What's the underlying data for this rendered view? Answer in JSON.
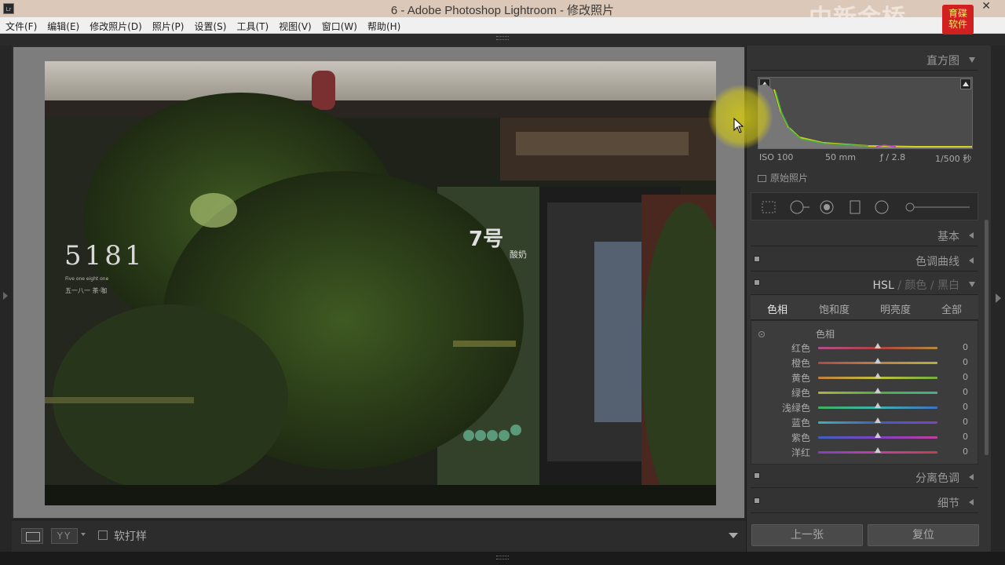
{
  "window": {
    "app_icon": "Lr",
    "title": "6 - Adobe Photoshop Lightroom - 修改照片",
    "watermark": "中新金桥",
    "badge_line1": "育碟",
    "badge_line2": "软件",
    "close": "✕"
  },
  "menu": {
    "file": "文件(F)",
    "edit": "编辑(E)",
    "develop": "修改照片(D)",
    "photo": "照片(P)",
    "settings": "设置(S)",
    "tools": "工具(T)",
    "view": "视图(V)",
    "window": "窗口(W)",
    "help": "帮助(H)"
  },
  "photo": {
    "sign_number": "5181",
    "sign_sub": "Five one eight one",
    "sign_sub2": "五一八一 茶·咖",
    "door_logo": "7号",
    "door_text": "酸奶"
  },
  "toolbar": {
    "yy": "YY",
    "soft_proof_label": "软打样"
  },
  "panel": {
    "histogram": {
      "title": "直方图",
      "iso": "ISO 100",
      "focal": "50 mm",
      "aperture": "ƒ / 2.8",
      "shutter": "1/500 秒",
      "original_photo": "原始照片"
    },
    "basic": "基本",
    "tone_curve": "色调曲线",
    "hsl_header": {
      "hsl": "HSL",
      "sep1": "/",
      "color": "颜色",
      "sep2": "/",
      "bw": "黑白"
    },
    "hsl_tabs": {
      "hue": "色相",
      "saturation": "饱和度",
      "luminance": "明亮度",
      "all": "全部"
    },
    "hsl_section_title": "色相",
    "hsl_rows": [
      {
        "label": "红色",
        "value": "0",
        "gradient": "linear-gradient(to right, #b0508a, #b04040, #b08a40)"
      },
      {
        "label": "橙色",
        "value": "0",
        "gradient": "linear-gradient(to right, #b04848, #c08040, #b0b040)"
      },
      {
        "label": "黄色",
        "value": "0",
        "gradient": "linear-gradient(to right, #c08040, #c0c040, #70b040)"
      },
      {
        "label": "绿色",
        "value": "0",
        "gradient": "linear-gradient(to right, #b0b040, #50b040, #40b090)"
      },
      {
        "label": "浅绿色",
        "value": "0",
        "gradient": "linear-gradient(to right, #40b060, #40b0b0, #4070c0)"
      },
      {
        "label": "蓝色",
        "value": "0",
        "gradient": "linear-gradient(to right, #40b0b0, #4060c0, #8040c0)"
      },
      {
        "label": "紫色",
        "value": "0",
        "gradient": "linear-gradient(to right, #4060c0, #8040c0, #c040a0)"
      },
      {
        "label": "洋红",
        "value": "0",
        "gradient": "linear-gradient(to right, #8040c0, #c040a0, #c04050)"
      }
    ],
    "split_toning": "分离色调",
    "detail": "细节",
    "prev_button": "上一张",
    "reset_button": "复位"
  },
  "colors": {
    "panel_bg": "#333333",
    "workspace_gray": "#7d7d7d",
    "cursor_highlight": "#d2c814"
  }
}
